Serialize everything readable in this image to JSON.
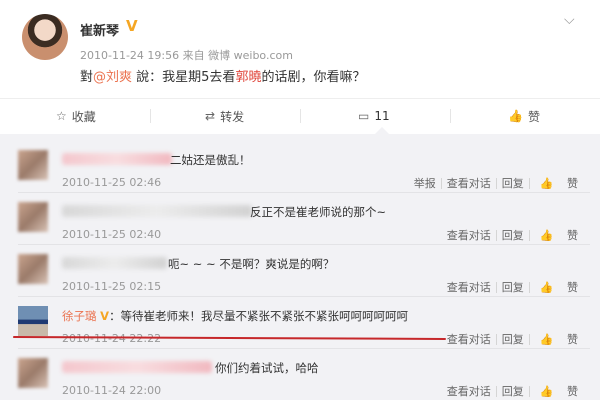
{
  "post": {
    "author": "崔新琴",
    "verified_badge": "V",
    "timestamp": "2010-11-24 19:56",
    "source_prefix": "来自",
    "source": "微博 weibo.com",
    "content_pre": "對",
    "content_mention": "@刘爽",
    "content_mid": " 說：我星期5去看",
    "content_highlight": "郭曉",
    "content_post": "的话剧，你看嘛？",
    "menu_icon": "chevron-down-icon"
  },
  "actions": {
    "favorite": "收藏",
    "repost": "转发",
    "comment": "11",
    "like": "赞"
  },
  "comments": [
    {
      "text": "二姑还是傲乱！",
      "time": "2010-11-25 02:46",
      "report": "举报",
      "view": "查看对话",
      "reply": "回复",
      "like": "赞"
    },
    {
      "text": "反正不是崔老师说的那个~",
      "time": "2010-11-25 02:40",
      "view": "查看对话",
      "reply": "回复",
      "like": "赞"
    },
    {
      "text": "呃~ ~ ~ 不是啊？爽说是的啊？",
      "time": "2010-11-25 02:15",
      "view": "查看对话",
      "reply": "回复",
      "like": "赞"
    },
    {
      "name": "徐子璐",
      "badge": "V",
      "text": "：等待崔老师来！我尽量不紧张不紧张不紧张呵呵呵呵呵呵",
      "time": "2010-11-24 22:22",
      "view": "查看对话",
      "reply": "回复",
      "like": "赞"
    },
    {
      "text": "你们约着试试，哈哈",
      "time": "2010-11-24 22:00",
      "view": "查看对话",
      "reply": "回复",
      "like": "赞"
    }
  ],
  "colors": {
    "link": "#eb7350",
    "highlight": "#e0463b",
    "annotation_line": "#c6282b",
    "verified": "#f5a623"
  }
}
